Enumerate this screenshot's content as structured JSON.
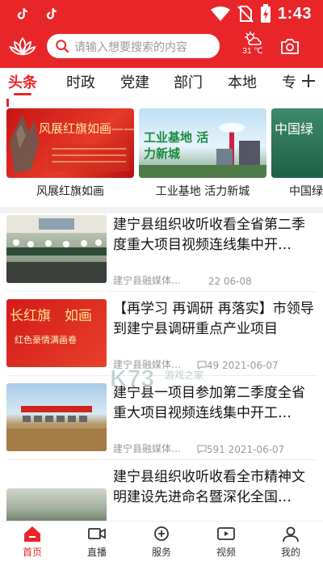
{
  "status_bar": {
    "time": "1:43",
    "left_icons": [
      "tiktok-icon",
      "tiktok-icon"
    ],
    "right_icons": [
      "wifi-icon",
      "sim-off-icon",
      "battery-charging-icon"
    ]
  },
  "header": {
    "search_placeholder": "请输入想要搜索的内容",
    "weather_temp": "31 ℃",
    "brand_color": "#e8262a"
  },
  "tabs": [
    {
      "label": "头条",
      "active": true
    },
    {
      "label": "时政",
      "active": false
    },
    {
      "label": "党建",
      "active": false
    },
    {
      "label": "部门",
      "active": false
    },
    {
      "label": "本地",
      "active": false
    },
    {
      "label": "专",
      "active": false
    }
  ],
  "featured": {
    "cards": [
      {
        "caption": "风展红旗如画",
        "image_text": "风展红旗如画——三明"
      },
      {
        "caption": "工业基地 活力新城",
        "image_text": "工业基地 活力新城"
      },
      {
        "caption": "中国绿",
        "image_text": "中国绿"
      }
    ]
  },
  "news": [
    {
      "title": "建宁县组织收听收看全省第二季度重大项目视频连线集中开…",
      "source": "建宁县融媒体…",
      "comments": "",
      "date": "22 06-08"
    },
    {
      "title": "【再学习 再调研 再落实】市领导到建宁县调研重点产业项目",
      "source": "建宁县融媒体…",
      "comments": "49",
      "date": "2021-06-07"
    },
    {
      "title": "建宁县一项目参加第二季度全省重大项目视频连线集中开工…",
      "source": "建宁县融媒体…",
      "comments": "591",
      "date": "2021-06-07"
    },
    {
      "title": "建宁县组织收听收看全市精神文明建设先进命名暨深化全国…",
      "source": "",
      "comments": "",
      "date": ""
    }
  ],
  "bottom_nav": [
    {
      "label": "首页",
      "icon": "home-icon",
      "active": true
    },
    {
      "label": "直播",
      "icon": "video-icon",
      "active": false
    },
    {
      "label": "服务",
      "icon": "service-icon",
      "active": false
    },
    {
      "label": "视频",
      "icon": "tv-icon",
      "active": false
    },
    {
      "label": "我的",
      "icon": "user-icon",
      "active": false
    }
  ],
  "watermark": "K73 游戏之家"
}
